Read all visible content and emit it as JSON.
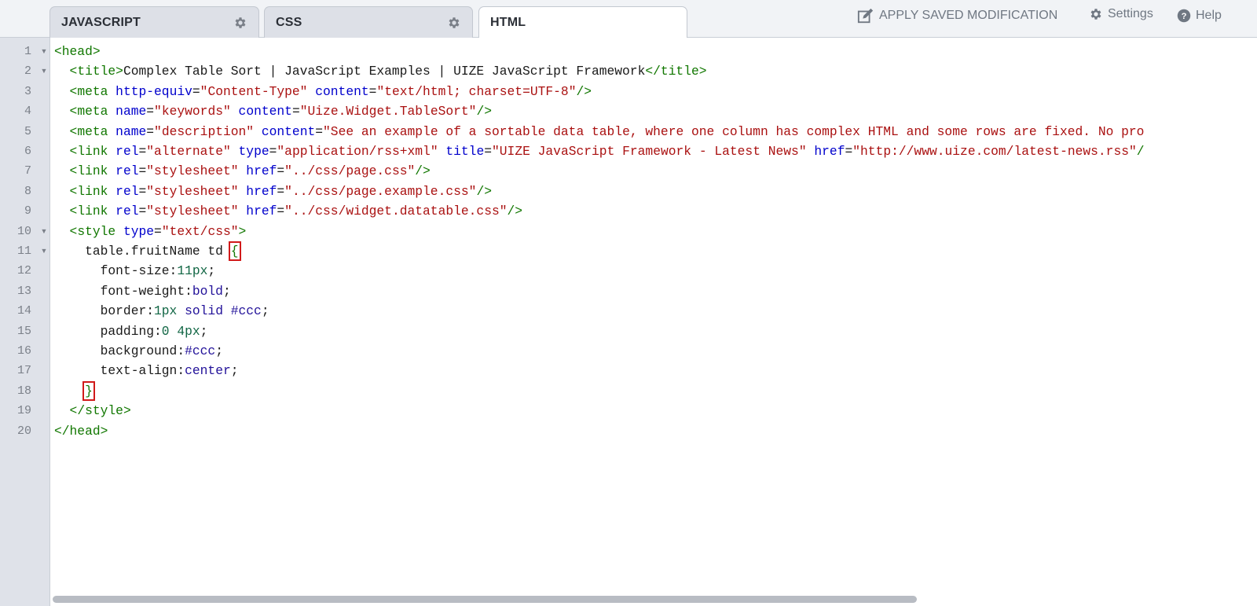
{
  "tabs": [
    {
      "label": "JAVASCRIPT",
      "has_settings": true
    },
    {
      "label": "CSS",
      "has_settings": true
    },
    {
      "label": "HTML",
      "active": true
    }
  ],
  "toolbar": {
    "apply": "APPLY SAVED MODIFICATION",
    "settings": "Settings",
    "help": "Help"
  },
  "gutter": {
    "numbers": [
      "1",
      "2",
      "3",
      "4",
      "5",
      "6",
      "7",
      "8",
      "9",
      "10",
      "11",
      "12",
      "13",
      "14",
      "15",
      "16",
      "17",
      "18",
      "19",
      "20"
    ],
    "fold_markers": [
      "▼",
      "▼",
      "",
      "",
      "",
      "",
      "",
      "",
      "",
      "▼",
      "▼",
      "",
      "",
      "",
      "",
      "",
      "",
      "",
      "",
      ""
    ]
  },
  "code_lines": [
    [
      [
        "tg",
        "<head>"
      ]
    ],
    [
      [
        "tx",
        "  "
      ],
      [
        "tg",
        "<title>"
      ],
      [
        "tx",
        "Complex Table Sort | JavaScript Examples | UIZE JavaScript Framework"
      ],
      [
        "tg",
        "</title>"
      ]
    ],
    [
      [
        "tx",
        "  "
      ],
      [
        "tg",
        "<meta "
      ],
      [
        "at",
        "http-equiv"
      ],
      [
        "tx",
        "="
      ],
      [
        "st",
        "\"Content-Type\""
      ],
      [
        "tx",
        " "
      ],
      [
        "at",
        "content"
      ],
      [
        "tx",
        "="
      ],
      [
        "st",
        "\"text/html; charset=UTF-8\""
      ],
      [
        "tg",
        "/>"
      ]
    ],
    [
      [
        "tx",
        "  "
      ],
      [
        "tg",
        "<meta "
      ],
      [
        "at",
        "name"
      ],
      [
        "tx",
        "="
      ],
      [
        "st",
        "\"keywords\""
      ],
      [
        "tx",
        " "
      ],
      [
        "at",
        "content"
      ],
      [
        "tx",
        "="
      ],
      [
        "st",
        "\"Uize.Widget.TableSort\""
      ],
      [
        "tg",
        "/>"
      ]
    ],
    [
      [
        "tx",
        "  "
      ],
      [
        "tg",
        "<meta "
      ],
      [
        "at",
        "name"
      ],
      [
        "tx",
        "="
      ],
      [
        "st",
        "\"description\""
      ],
      [
        "tx",
        " "
      ],
      [
        "at",
        "content"
      ],
      [
        "tx",
        "="
      ],
      [
        "st",
        "\"See an example of a sortable data table, where one column has complex HTML and some rows are fixed. No pro"
      ]
    ],
    [
      [
        "tx",
        "  "
      ],
      [
        "tg",
        "<link "
      ],
      [
        "at",
        "rel"
      ],
      [
        "tx",
        "="
      ],
      [
        "st",
        "\"alternate\""
      ],
      [
        "tx",
        " "
      ],
      [
        "at",
        "type"
      ],
      [
        "tx",
        "="
      ],
      [
        "st",
        "\"application/rss+xml\""
      ],
      [
        "tx",
        " "
      ],
      [
        "at",
        "title"
      ],
      [
        "tx",
        "="
      ],
      [
        "st",
        "\"UIZE JavaScript Framework - Latest News\""
      ],
      [
        "tx",
        " "
      ],
      [
        "at",
        "href"
      ],
      [
        "tx",
        "="
      ],
      [
        "st",
        "\"http://www.uize.com/latest-news.rss\""
      ],
      [
        "tg",
        "/"
      ]
    ],
    [
      [
        "tx",
        "  "
      ],
      [
        "tg",
        "<link "
      ],
      [
        "at",
        "rel"
      ],
      [
        "tx",
        "="
      ],
      [
        "st",
        "\"stylesheet\""
      ],
      [
        "tx",
        " "
      ],
      [
        "at",
        "href"
      ],
      [
        "tx",
        "="
      ],
      [
        "st",
        "\"../css/page.css\""
      ],
      [
        "tg",
        "/>"
      ]
    ],
    [
      [
        "tx",
        "  "
      ],
      [
        "tg",
        "<link "
      ],
      [
        "at",
        "rel"
      ],
      [
        "tx",
        "="
      ],
      [
        "st",
        "\"stylesheet\""
      ],
      [
        "tx",
        " "
      ],
      [
        "at",
        "href"
      ],
      [
        "tx",
        "="
      ],
      [
        "st",
        "\"../css/page.example.css\""
      ],
      [
        "tg",
        "/>"
      ]
    ],
    [
      [
        "tx",
        "  "
      ],
      [
        "tg",
        "<link "
      ],
      [
        "at",
        "rel"
      ],
      [
        "tx",
        "="
      ],
      [
        "st",
        "\"stylesheet\""
      ],
      [
        "tx",
        " "
      ],
      [
        "at",
        "href"
      ],
      [
        "tx",
        "="
      ],
      [
        "st",
        "\"../css/widget.datatable.css\""
      ],
      [
        "tg",
        "/>"
      ]
    ],
    [
      [
        "tx",
        "  "
      ],
      [
        "tg",
        "<style "
      ],
      [
        "at",
        "type"
      ],
      [
        "tx",
        "="
      ],
      [
        "st",
        "\"text/css\""
      ],
      [
        "tg",
        ">"
      ]
    ],
    [
      [
        "tx",
        "    table.fruitName td "
      ],
      [
        "tg",
        "{",
        "hl"
      ]
    ],
    [
      [
        "tx",
        "      font-size:"
      ],
      [
        "nm",
        "11px"
      ],
      [
        "tx",
        ";"
      ]
    ],
    [
      [
        "tx",
        "      font-weight:"
      ],
      [
        "kw",
        "bold"
      ],
      [
        "tx",
        ";"
      ]
    ],
    [
      [
        "tx",
        "      border:"
      ],
      [
        "nm",
        "1px"
      ],
      [
        "tx",
        " "
      ],
      [
        "kw",
        "solid"
      ],
      [
        "tx",
        " "
      ],
      [
        "kw",
        "#ccc"
      ],
      [
        "tx",
        ";"
      ]
    ],
    [
      [
        "tx",
        "      padding:"
      ],
      [
        "nm",
        "0"
      ],
      [
        "tx",
        " "
      ],
      [
        "nm",
        "4px"
      ],
      [
        "tx",
        ";"
      ]
    ],
    [
      [
        "tx",
        "      background:"
      ],
      [
        "kw",
        "#ccc"
      ],
      [
        "tx",
        ";"
      ]
    ],
    [
      [
        "tx",
        "      text-align:"
      ],
      [
        "kw",
        "center"
      ],
      [
        "tx",
        ";"
      ]
    ],
    [
      [
        "tx",
        "    "
      ],
      [
        "tg",
        "}",
        "hl"
      ]
    ],
    [
      [
        "tx",
        "  "
      ],
      [
        "tg",
        "</style>"
      ]
    ],
    [
      [
        "tg",
        "</head>"
      ]
    ]
  ],
  "colors": {
    "tag": "#117700",
    "attribute": "#0000cc",
    "string": "#aa1111",
    "number": "#116644",
    "keyword": "#221199",
    "highlight": "#d11a1a"
  }
}
